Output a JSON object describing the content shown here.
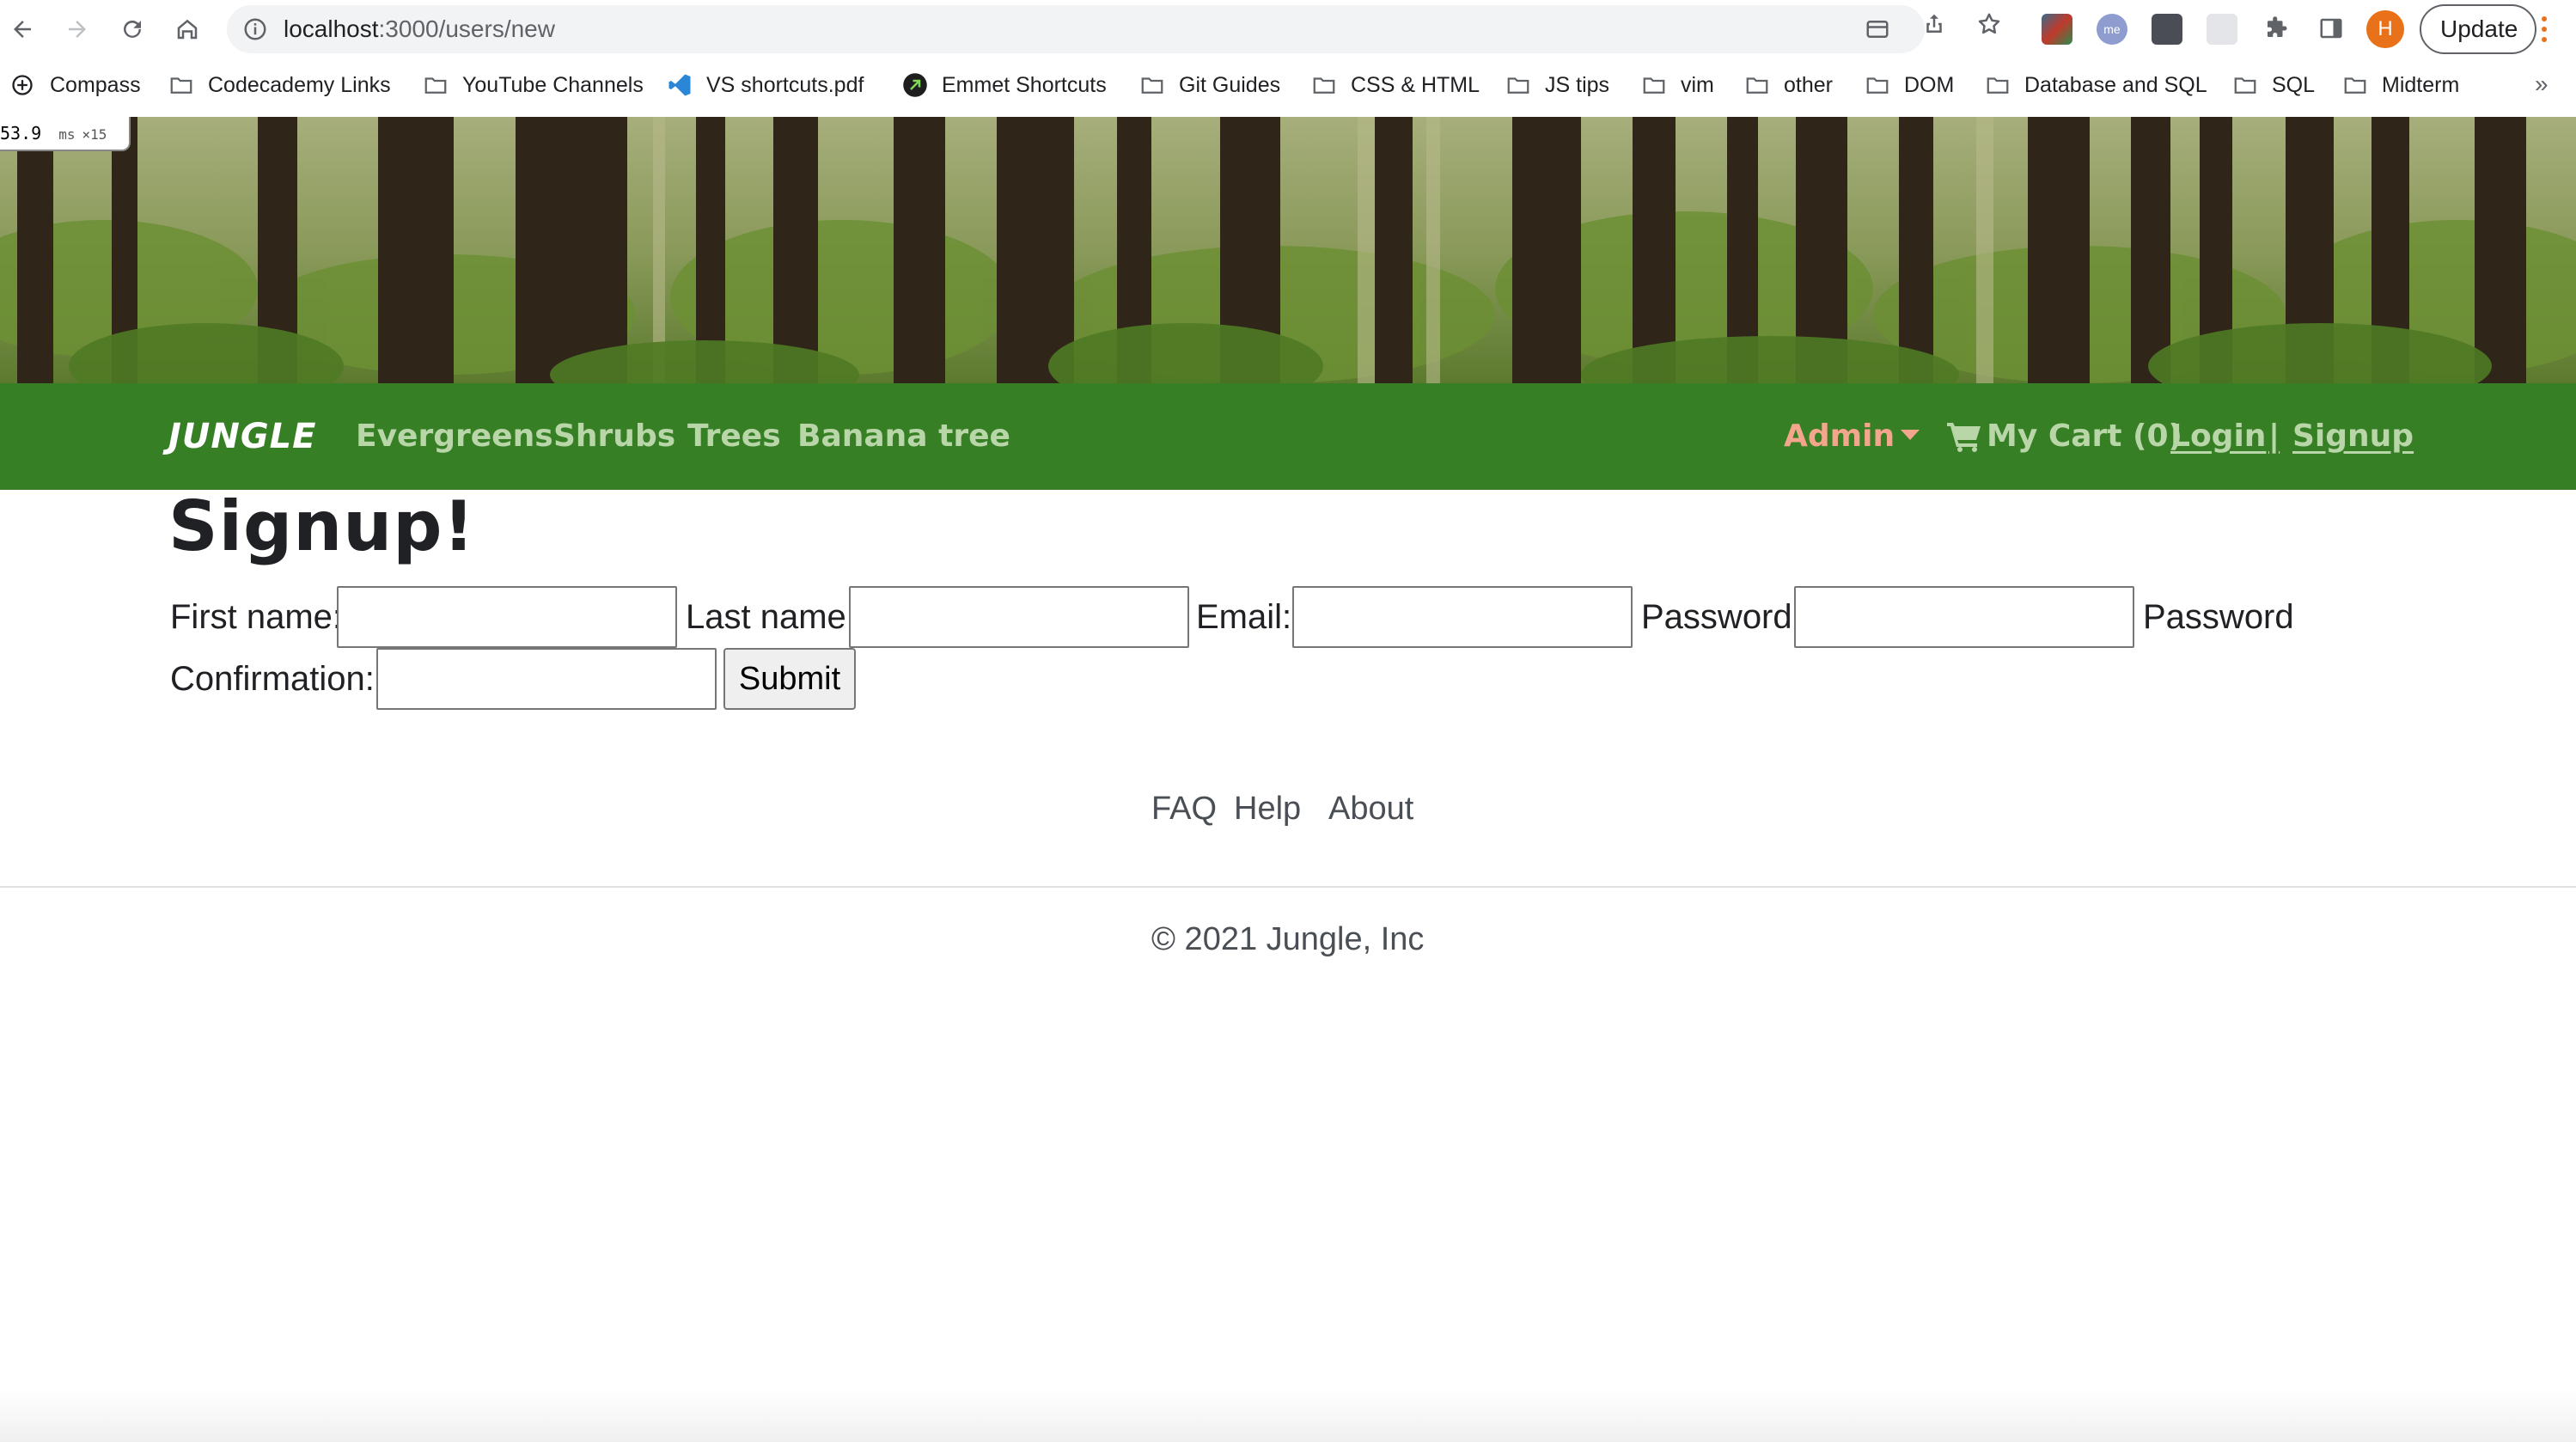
{
  "browser": {
    "url_host": "localhost",
    "url_path": ":3000/users/new",
    "profile_initial": "H",
    "update_label": "Update"
  },
  "bookmarks": [
    {
      "label": "Compass",
      "icon": "compass-icon"
    },
    {
      "label": "Codecademy Links",
      "icon": "folder-icon"
    },
    {
      "label": "YouTube Channels",
      "icon": "folder-icon"
    },
    {
      "label": "VS shortcuts.pdf",
      "icon": "vscode-icon"
    },
    {
      "label": "Emmet Shortcuts",
      "icon": "emmet-icon"
    },
    {
      "label": "Git Guides",
      "icon": "folder-icon"
    },
    {
      "label": "CSS & HTML",
      "icon": "folder-icon"
    },
    {
      "label": "JS tips",
      "icon": "folder-icon"
    },
    {
      "label": "vim",
      "icon": "folder-icon"
    },
    {
      "label": "other",
      "icon": "folder-icon"
    },
    {
      "label": "DOM",
      "icon": "folder-icon"
    },
    {
      "label": "Database and SQL",
      "icon": "folder-icon"
    },
    {
      "label": "SQL",
      "icon": "folder-icon"
    },
    {
      "label": "Midterm",
      "icon": "folder-icon"
    }
  ],
  "bookmarks_more": "»",
  "perf": {
    "value": "53.9",
    "unit": "ms",
    "count": "×15"
  },
  "navbar": {
    "brand": "JUNGLE",
    "links": [
      "Evergreens",
      "Shrubs",
      "Trees",
      "Banana tree"
    ],
    "admin": "Admin",
    "cart": "My Cart (0)",
    "login": "Login",
    "separator": "|",
    "signup": "Signup"
  },
  "page": {
    "title": "Signup!",
    "form": {
      "first_name_label": "First name:",
      "last_name_label": "Last name:",
      "email_label": "Email:",
      "password_label": "Password:",
      "password_confirmation_label_1": "Password",
      "password_confirmation_label_2": "Confirmation:",
      "first_name_value": "",
      "last_name_value": "",
      "email_value": "",
      "password_value": "",
      "password_confirmation_value": "",
      "submit_label": "Submit"
    }
  },
  "footer": {
    "links": [
      "FAQ",
      "Help",
      "About"
    ],
    "copyright": "© 2021 Jungle, Inc"
  },
  "colors": {
    "navbar_bg": "#367f25",
    "nav_link": "#b9d6a9",
    "admin_link": "#f4a68c"
  }
}
